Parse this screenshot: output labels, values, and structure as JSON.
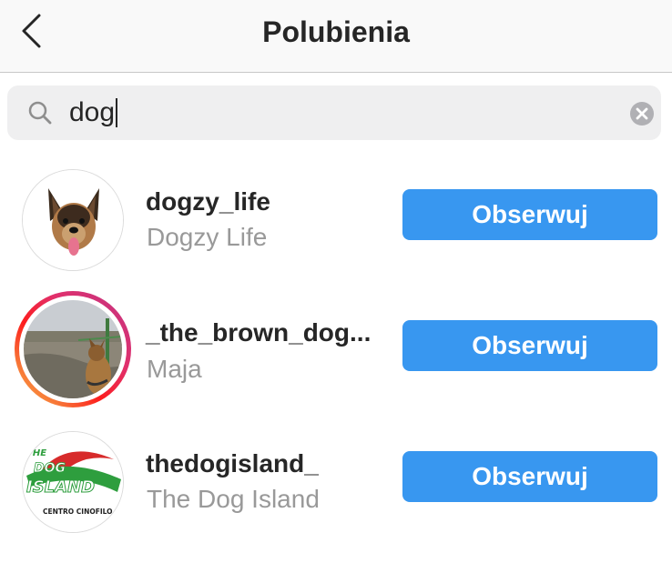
{
  "header": {
    "title": "Polubienia"
  },
  "search": {
    "value": "dog"
  },
  "colors": {
    "follow_button": "#3897f0",
    "fullname_text": "#999999",
    "header_bg": "#f9f9f9"
  },
  "results": [
    {
      "username": "dogzy_life",
      "fullname": "Dogzy Life",
      "button": "Obserwuj",
      "avatar": "german-shepherd-avatar"
    },
    {
      "username": "_the_brown_dog...",
      "fullname": "Maja",
      "button": "Obserwuj",
      "avatar": "brown-dog-photo-avatar",
      "has_story": true
    },
    {
      "username": "thedogisland_",
      "fullname": "The Dog Island",
      "button": "Obserwuj",
      "avatar": "dog-island-logo-avatar",
      "logo_text": {
        "line1": "THE",
        "line2": "DOG",
        "line3": "ISLAND",
        "subtitle": "CENTRO CINOFILO"
      }
    }
  ]
}
